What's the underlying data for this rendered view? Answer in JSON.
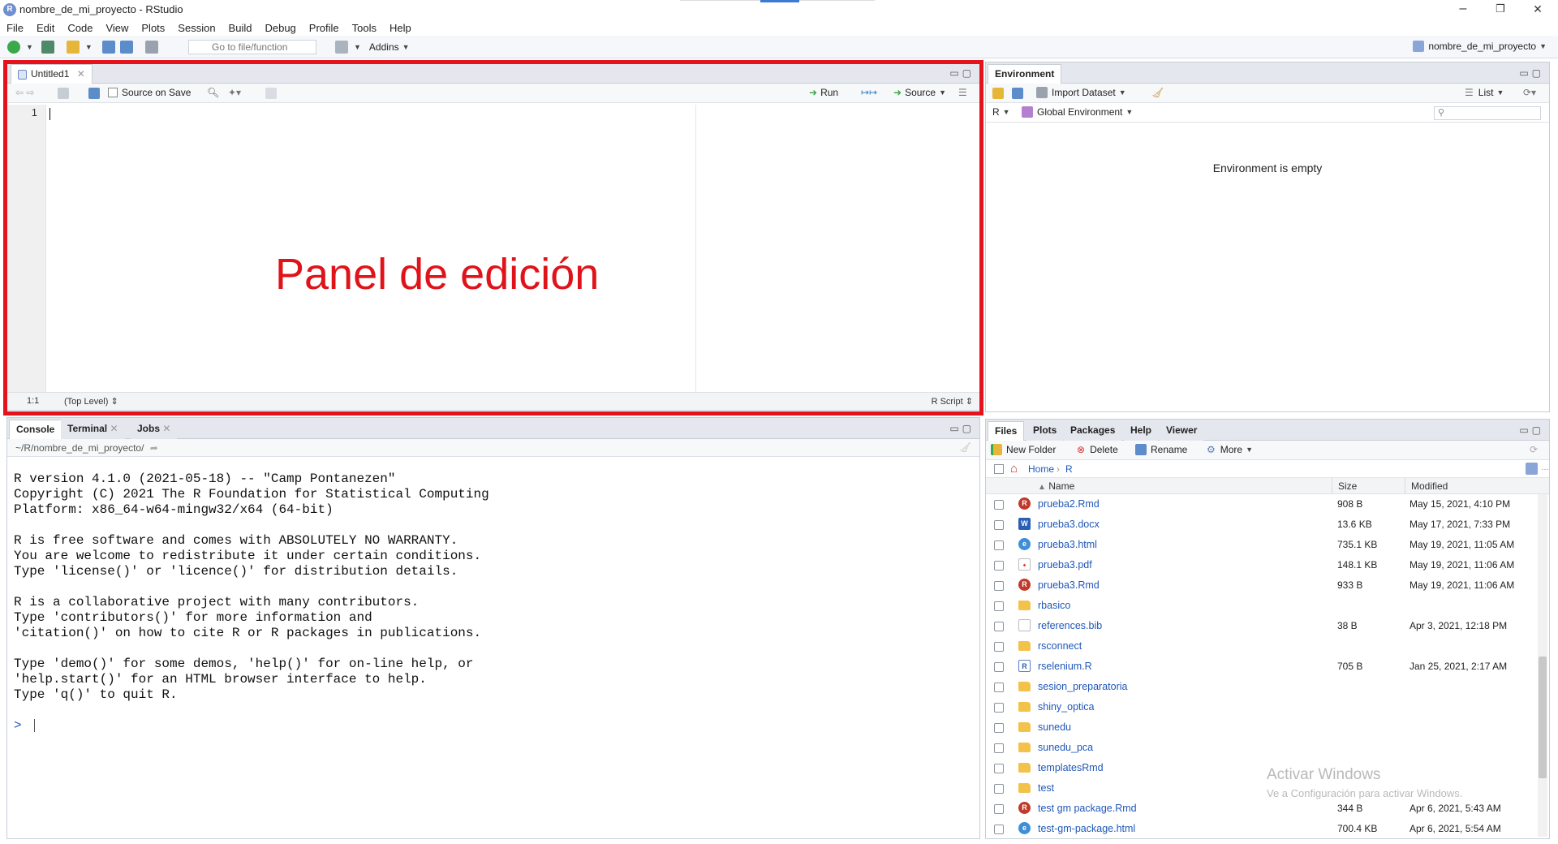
{
  "window": {
    "title": "nombre_de_mi_proyecto - RStudio",
    "minimize": "–",
    "restore": "❐",
    "close": "✕"
  },
  "menu": [
    "File",
    "Edit",
    "Code",
    "View",
    "Plots",
    "Session",
    "Build",
    "Debug",
    "Profile",
    "Tools",
    "Help"
  ],
  "toolbar": {
    "goto_placeholder": "Go to file/function",
    "addins": "Addins",
    "project": "nombre_de_mi_proyecto"
  },
  "editor": {
    "tab": "Untitled1",
    "source_on_save": "Source on Save",
    "run": "Run",
    "source": "Source",
    "line_number": "1",
    "position": "1:1",
    "scope": "(Top Level)",
    "filetype": "R Script",
    "overlay_label": "Panel de edición"
  },
  "environment": {
    "tabs": [
      "Environment"
    ],
    "import_dataset": "Import Dataset",
    "list": "List",
    "lang": "R",
    "scope": "Global Environment",
    "empty_message": "Environment is empty"
  },
  "console": {
    "tabs": [
      "Console",
      "Terminal",
      "Jobs"
    ],
    "path": "~/R/nombre_de_mi_proyecto/",
    "output": "R version 4.1.0 (2021-05-18) -- \"Camp Pontanezen\"\nCopyright (C) 2021 The R Foundation for Statistical Computing\nPlatform: x86_64-w64-mingw32/x64 (64-bit)\n\nR is free software and comes with ABSOLUTELY NO WARRANTY.\nYou are welcome to redistribute it under certain conditions.\nType 'license()' or 'licence()' for distribution details.\n\nR is a collaborative project with many contributors.\nType 'contributors()' for more information and\n'citation()' on how to cite R or R packages in publications.\n\nType 'demo()' for some demos, 'help()' for on-line help, or\n'help.start()' for an HTML browser interface to help.\nType 'q()' to quit R.",
    "prompt": ">"
  },
  "files": {
    "tabs": [
      "Files",
      "Plots",
      "Packages",
      "Help",
      "Viewer"
    ],
    "new_folder": "New Folder",
    "delete": "Delete",
    "rename": "Rename",
    "more": "More",
    "breadcrumb": [
      "Home",
      "R"
    ],
    "columns": {
      "name": "Name",
      "size": "Size",
      "modified": "Modified"
    },
    "rows": [
      {
        "name": "prueba2.Rmd",
        "size": "908 B",
        "modified": "May 15, 2021, 4:10 PM",
        "icon": "rmd"
      },
      {
        "name": "prueba3.docx",
        "size": "13.6 KB",
        "modified": "May 17, 2021, 7:33 PM",
        "icon": "docx"
      },
      {
        "name": "prueba3.html",
        "size": "735.1 KB",
        "modified": "May 19, 2021, 11:05 AM",
        "icon": "html"
      },
      {
        "name": "prueba3.pdf",
        "size": "148.1 KB",
        "modified": "May 19, 2021, 11:06 AM",
        "icon": "pdf"
      },
      {
        "name": "prueba3.Rmd",
        "size": "933 B",
        "modified": "May 19, 2021, 11:06 AM",
        "icon": "rmd"
      },
      {
        "name": "rbasico",
        "size": "",
        "modified": "",
        "icon": "folder"
      },
      {
        "name": "references.bib",
        "size": "38 B",
        "modified": "Apr 3, 2021, 12:18 PM",
        "icon": "bib"
      },
      {
        "name": "rsconnect",
        "size": "",
        "modified": "",
        "icon": "folder"
      },
      {
        "name": "rselenium.R",
        "size": "705 B",
        "modified": "Jan 25, 2021, 2:17 AM",
        "icon": "r"
      },
      {
        "name": "sesion_preparatoria",
        "size": "",
        "modified": "",
        "icon": "folder"
      },
      {
        "name": "shiny_optica",
        "size": "",
        "modified": "",
        "icon": "folder"
      },
      {
        "name": "sunedu",
        "size": "",
        "modified": "",
        "icon": "folder"
      },
      {
        "name": "sunedu_pca",
        "size": "",
        "modified": "",
        "icon": "folder"
      },
      {
        "name": "templatesRmd",
        "size": "",
        "modified": "",
        "icon": "folder"
      },
      {
        "name": "test",
        "size": "",
        "modified": "",
        "icon": "folder"
      },
      {
        "name": "test gm package.Rmd",
        "size": "344 B",
        "modified": "Apr 6, 2021, 5:43 AM",
        "icon": "rmd"
      },
      {
        "name": "test-gm-package.html",
        "size": "700.4 KB",
        "modified": "Apr 6, 2021, 5:54 AM",
        "icon": "html"
      }
    ]
  },
  "watermark": {
    "line1": "Activar Windows",
    "line2": "Ve a Configuración para activar Windows."
  }
}
